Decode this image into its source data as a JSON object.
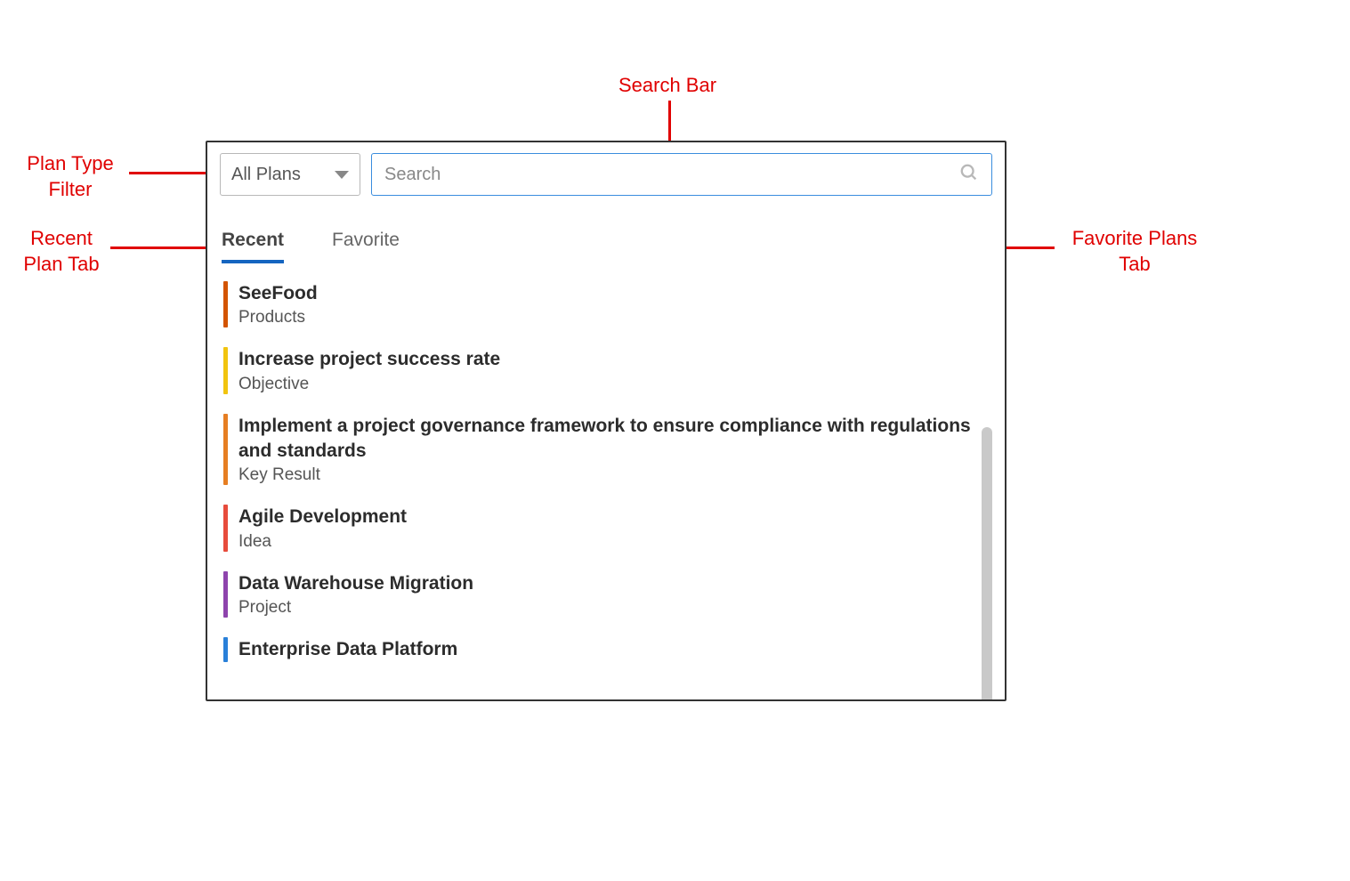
{
  "annotations": {
    "search_bar": "Search Bar",
    "plan_type_filter_line1": "Plan Type",
    "plan_type_filter_line2": "Filter",
    "recent_tab_line1": "Recent",
    "recent_tab_line2": "Plan Tab",
    "favorite_tab_line1": "Favorite Plans",
    "favorite_tab_line2": "Tab"
  },
  "dropdown": {
    "label": "All Plans"
  },
  "search": {
    "placeholder": "Search"
  },
  "tabs": {
    "recent": "Recent",
    "favorite": "Favorite"
  },
  "items": [
    {
      "title": "SeeFood",
      "subtitle": "Products",
      "color": "#d35400"
    },
    {
      "title": "Increase project success rate",
      "subtitle": "Objective",
      "color": "#f1c40f"
    },
    {
      "title": "Implement a project governance framework to ensure compliance with regulations and standards",
      "subtitle": "Key Result",
      "color": "#e67e22"
    },
    {
      "title": "Agile Development",
      "subtitle": "Idea",
      "color": "#e74c3c"
    },
    {
      "title": "Data Warehouse Migration",
      "subtitle": "Project",
      "color": "#8e44ad"
    },
    {
      "title": "Enterprise Data Platform",
      "subtitle": "",
      "color": "#2980d9"
    }
  ]
}
